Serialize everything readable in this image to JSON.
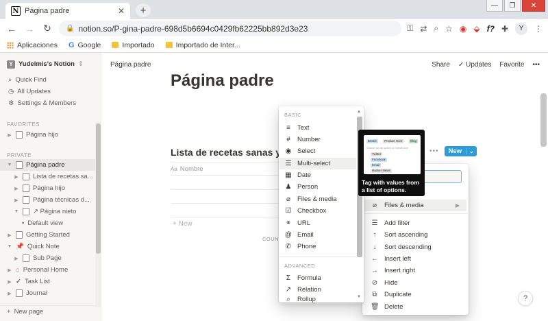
{
  "browser": {
    "tab_title": "Página padre",
    "url": "notion.so/P-gina-padre-698d5b6694c0429fb62225bb892d3e23",
    "bookmarks": [
      "Aplicaciones",
      "Google",
      "Importado",
      "Importado de Inter..."
    ]
  },
  "sidebar": {
    "workspace": "Yudelmis's Notion",
    "quick_find": "Quick Find",
    "all_updates": "All Updates",
    "settings": "Settings & Members",
    "favorites_label": "FAVORITES",
    "favorites": [
      "Página hijo"
    ],
    "private_label": "PRIVATE",
    "items": [
      {
        "label": "Página padre"
      },
      {
        "label": "Lista de recetas sa..."
      },
      {
        "label": "Página hijo"
      },
      {
        "label": "Página técnicas d..."
      },
      {
        "label": "↗ Página nieto"
      },
      {
        "label": "Default view"
      },
      {
        "label": "Getting Started"
      },
      {
        "label": "Quick Note"
      },
      {
        "label": "Sub Page"
      },
      {
        "label": "Personal Home"
      },
      {
        "label": "Task List"
      },
      {
        "label": "Journal"
      }
    ],
    "new_page": "New page"
  },
  "topbar": {
    "breadcrumb": "Página padre",
    "share": "Share",
    "updates": "Updates",
    "favorite": "Favorite",
    "more": "•••"
  },
  "page": {
    "title": "Página padre",
    "database_title": "Lista de recetas sanas y rápi",
    "column_name": "Nombre",
    "column_icon": "Aa",
    "new_row": "New",
    "count_label": "COUNT",
    "new_button": "New",
    "help": "?"
  },
  "type_menu": {
    "basic_label": "BASIC",
    "basic": [
      "Text",
      "Number",
      "Select",
      "Multi-select",
      "Date",
      "Person",
      "Files & media",
      "Checkbox",
      "URL",
      "Email",
      "Phone"
    ],
    "advanced_label": "ADVANCED",
    "advanced": [
      "Formula",
      "Relation",
      "Rollup"
    ],
    "highlighted": "Multi-select"
  },
  "tooltip": {
    "text": "Tag with values from a list of options.",
    "preview_chips": [
      "Bristol",
      "Product Hunt",
      "Blog"
    ],
    "preview_search": "Search for an option or create one",
    "preview_options": [
      "Twitter",
      "Facebook",
      "Email",
      "Hacker News"
    ]
  },
  "property_menu": {
    "type_item": "Files & media",
    "actions": [
      "Add filter",
      "Sort ascending",
      "Sort descending",
      "Insert left",
      "Insert right",
      "Hide",
      "Duplicate",
      "Delete"
    ]
  },
  "colors": {
    "accent_blue": "#2e9bd6",
    "sidebar_bg": "#f7f6f3",
    "tooltip_bg": "#0f0f0f"
  }
}
